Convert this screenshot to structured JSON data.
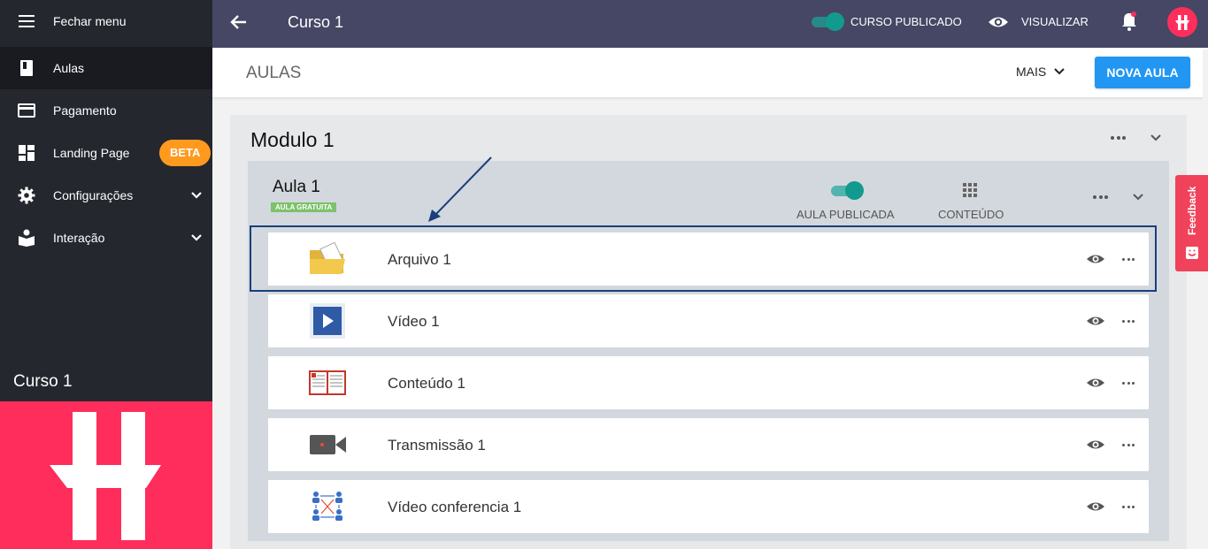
{
  "sidebar": {
    "close_menu": "Fechar menu",
    "items": [
      {
        "label": "Aulas",
        "icon": "book-icon"
      },
      {
        "label": "Pagamento",
        "icon": "credit-card-icon"
      },
      {
        "label": "Landing Page",
        "icon": "dashboard-icon",
        "badge": "BETA"
      },
      {
        "label": "Configurações",
        "icon": "gear-icon"
      },
      {
        "label": "Interação",
        "icon": "reading-icon"
      }
    ],
    "course_name": "Curso 1"
  },
  "topbar": {
    "title": "Curso 1",
    "published_label": "CURSO PUBLICADO",
    "view_label": "VISUALIZAR"
  },
  "header": {
    "title": "AULAS",
    "more_label": "MAIS",
    "new_lesson_label": "NOVA AULA"
  },
  "module": {
    "title": "Modulo 1",
    "lesson": {
      "title": "Aula 1",
      "badge": "AULA GRATUITA",
      "published_label": "AULA PUBLICADA",
      "content_label": "CONTEÚDO",
      "items": [
        {
          "label": "Arquivo 1",
          "icon": "folder-icon"
        },
        {
          "label": "Vídeo 1",
          "icon": "video-file-icon"
        },
        {
          "label": "Conteúdo 1",
          "icon": "open-book-icon"
        },
        {
          "label": "Transmissão 1",
          "icon": "camera-icon"
        },
        {
          "label": "Vídeo conferencia 1",
          "icon": "conference-icon"
        }
      ]
    }
  },
  "feedback_label": "Feedback",
  "colors": {
    "sidebar": "#25272f",
    "topbar": "#454764",
    "brand": "#ff2d5c",
    "accent_blue": "#2196f3",
    "toggle": "#139a8f",
    "beta": "#ff9a1f"
  }
}
